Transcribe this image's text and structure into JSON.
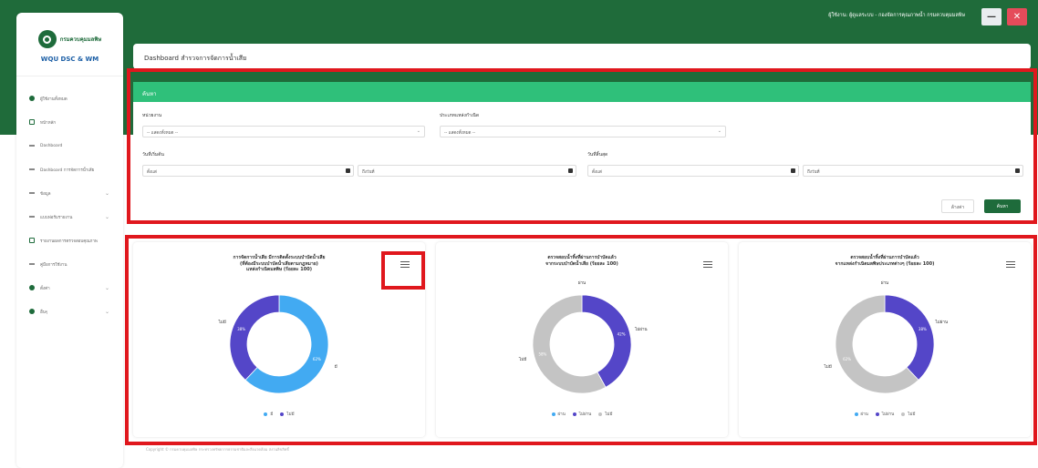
{
  "topbar": {
    "user_text": "ผู้ใช้งาน: ผู้ดูแลระบบ - กองจัดการคุณภาพน้ำ กรมควบคุมมลพิษ",
    "minimize_label": "—",
    "close_label": "✕",
    "colors": {
      "background": "#1f6b3a",
      "close": "#e54b5a"
    }
  },
  "sidebar": {
    "logo_text": "กรมควบคุมมลพิษ",
    "app_name": "WQU DSC & WM",
    "items": [
      {
        "label": "ผู้ใช้งานทั้งหมด",
        "icon": "dot-icon",
        "chevron": ""
      },
      {
        "label": "หน้าหลัก",
        "icon": "document-icon",
        "chevron": ""
      },
      {
        "label": "Dashboard",
        "icon": "line-icon",
        "chevron": ""
      },
      {
        "label": "Dashboard การจัดการน้ำเสีย",
        "icon": "line-icon",
        "chevron": ""
      },
      {
        "label": "ข้อมูล",
        "icon": "line-icon",
        "chevron": "⌄"
      },
      {
        "label": "แบบฟอร์มรายงาน",
        "icon": "line-icon",
        "chevron": "⌄"
      },
      {
        "label": "รายงานผลการตรวจสอบคุณภาพ",
        "icon": "document-icon",
        "chevron": ""
      },
      {
        "label": "คู่มือการใช้งาน",
        "icon": "line-icon",
        "chevron": ""
      },
      {
        "label": "ตั้งค่า",
        "icon": "dot-icon",
        "chevron": "⌄"
      },
      {
        "label": "อื่นๆ",
        "icon": "dot-icon",
        "chevron": "⌄"
      }
    ]
  },
  "page": {
    "title": "Dashboard สำรวจการจัดการน้ำเสีย"
  },
  "filters": {
    "header": "ค้นหา",
    "agency": {
      "label": "หน่วยงาน",
      "value": "-- แสดงทั้งหมด --"
    },
    "source_type": {
      "label": "ประเภทแหล่งกำเนิด",
      "value": "-- แสดงทั้งหมด --"
    },
    "start_date": {
      "label": "วันที่เริ่มต้น",
      "from": "ตั้งแต่",
      "to": "ถึงวันที่"
    },
    "end_date": {
      "label": "วันที่สิ้นสุด",
      "from": "ตั้งแต่",
      "to": "ถึงวันที่"
    },
    "clear_button": "ล้างค่า",
    "search_button": "ค้นหา",
    "colors": {
      "header": "#2fc07a",
      "search_button": "#1e6b3b"
    }
  },
  "charts": [
    {
      "title_lines": [
        "การจัดการน้ำเสีย มีการติดตั้งระบบบำบัดน้ำเสีย",
        "(ที่ต้องมีระบบบำบัดน้ำเสียตามกฎหมาย)",
        "แหล่งกำเนิดมลพิษ (ร้อยละ 100)"
      ],
      "legend": [
        "มี",
        "ไม่มี"
      ]
    },
    {
      "title_lines": [
        "ตรวจสอบน้ำทิ้งที่ผ่านการบำบัดแล้ว",
        "จากระบบบำบัดน้ำเสีย (ร้อยละ 100)"
      ],
      "legend": [
        "ผ่าน",
        "ไม่ผ่าน",
        "ไม่มี"
      ]
    },
    {
      "title_lines": [
        "ตรวจสอบน้ำทิ้งที่ผ่านการบำบัดแล้ว",
        "จากแหล่งกำเนิดมลพิษประเภทต่างๆ (ร้อยละ 100)"
      ],
      "legend": [
        "ผ่าน",
        "ไม่ผ่าน",
        "ไม่มี"
      ]
    }
  ],
  "chart_data": [
    {
      "type": "pie",
      "variant": "donut",
      "categories": [
        "มี",
        "ไม่มี"
      ],
      "values": [
        62,
        38
      ],
      "colors": [
        "#42aaf2",
        "#5446c8"
      ],
      "slice_labels": [
        "มี",
        "ไม่มี"
      ],
      "value_labels": [
        "62%",
        "38%"
      ]
    },
    {
      "type": "pie",
      "variant": "donut",
      "categories": [
        "ผ่าน",
        "ไม่ผ่าน",
        "ไม่มี"
      ],
      "values": [
        0,
        42,
        58
      ],
      "colors": [
        "#42aaf2",
        "#5446c8",
        "#c4c4c4"
      ],
      "slice_labels": [
        "ผ่าน",
        "ไม่ผ่าน",
        "ไม่มี"
      ],
      "value_labels": [
        "0%",
        "42%",
        "58%"
      ]
    },
    {
      "type": "pie",
      "variant": "donut",
      "categories": [
        "ผ่าน",
        "ไม่ผ่าน",
        "ไม่มี"
      ],
      "values": [
        0,
        38,
        62
      ],
      "colors": [
        "#42aaf2",
        "#5446c8",
        "#c4c4c4"
      ],
      "slice_labels": [
        "ผ่าน",
        "ไม่ผ่าน",
        "ไม่มี"
      ],
      "value_labels": [
        "0%",
        "38%",
        "62%"
      ]
    }
  ],
  "footer": {
    "text": "Copyright © กรมควบคุมมลพิษ กระทรวงทรัพยากรธรรมชาติและสิ่งแวดล้อม สงวนลิขสิทธิ์"
  },
  "annotations": {
    "highlight_color": "#e0171d"
  }
}
